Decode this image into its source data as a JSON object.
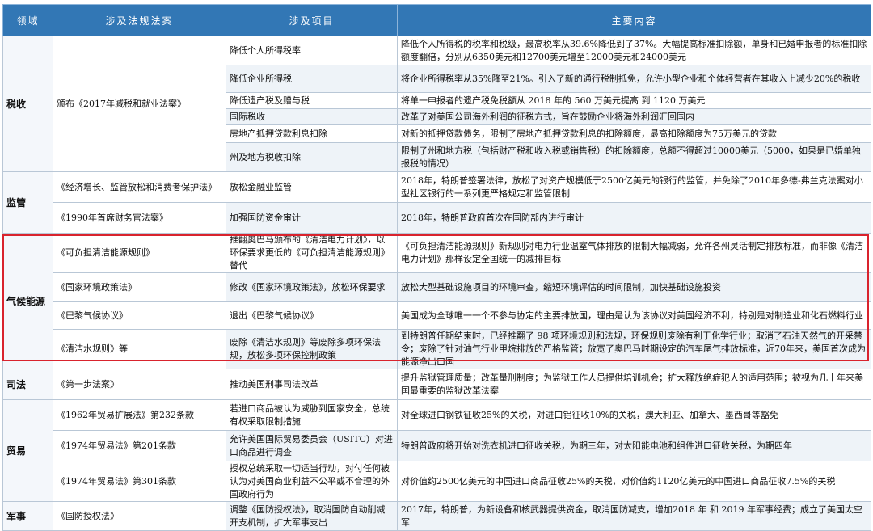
{
  "headers": {
    "domain": "领域",
    "law": "涉及法规法案",
    "item": "涉及项目",
    "content": "主要内容"
  },
  "sections": {
    "tax": {
      "domain": "税收",
      "law": "颁布《2017年减税和就业法案》",
      "rows": [
        {
          "item": "降低个人所得税率",
          "content": "降低个人所得税的税率和税级，最高税率从39.6%降低到了37%。大幅提高标准扣除额，单身和已婚申报者的标准扣除额度翻倍，分别从6350美元和12700美元增至12000美元和24000美元"
        },
        {
          "item": "降低企业所得税",
          "content": "将企业所得税率从35%降至21%。引入了新的通行税制抵免，允许小型企业和个体经营者在其收入上减少20%的税收"
        },
        {
          "item": "降低遗产税及赠与税",
          "content": "将单一申报者的遗产税免税额从 2018 年的 560 万美元提高 到 1120 万美元"
        },
        {
          "item": "国际税收",
          "content": "改革了对美国公司海外利润的征税方式，旨在鼓励企业将海外利润汇回国内"
        },
        {
          "item": "房地产抵押贷款利息扣除",
          "content": "对新的抵押贷款债务，限制了房地产抵押贷款利息的扣除额度，最高扣除额度为75万美元的贷款"
        },
        {
          "item": "州及地方税收扣除",
          "content": "限制了州和地方税（包括财产税和收入税或销售税）的扣除额度，总额不得超过10000美元（5000，如果是已婚单独报税的情况）"
        }
      ]
    },
    "reg": {
      "domain": "监管",
      "rows": [
        {
          "law": "《经济增长、监管放松和消费者保护法》",
          "item": "放松金融业监管",
          "content": "2018年，特朗普签署法律，放松了对资产规模低于2500亿美元的银行的监管，并免除了2010年多德-弗兰克法案对小型社区银行的一系列更严格规定和监管限制"
        },
        {
          "law": "《1990年首席财务官法案》",
          "item": "加强国防资金审计",
          "content": "2018年，特朗普政府首次在国防部内进行审计"
        }
      ]
    },
    "climate": {
      "domain": "气候能源",
      "rows": [
        {
          "law": "《可负担清洁能源规则》",
          "item": "推翻奥巴马颁布的《清洁电力计划》，以环保要求更低的《可负担清洁能源规则》替代",
          "content": "《可负担清洁能源规则》新规则对电力行业温室气体排放的限制大幅减弱，允许各州灵活制定排放标准，而非像《清洁电力计划》那样设定全国统一的减排目标"
        },
        {
          "law": "《国家环境政策法》",
          "item": "修改《国家环境政策法》，放松环保要求",
          "content": "放松大型基础设施项目的环境审查，缩短环境评估的时间限制，加快基础设施投资"
        },
        {
          "law": "《巴黎气候协议》",
          "item": "退出《巴黎气候协议》",
          "content": "美国成为全球唯一一个不参与协定的主要排放国，理由是认为该协议对美国经济不利，特别是对制造业和化石燃料行业"
        },
        {
          "law": "《清洁水规则》等",
          "item": "废除《清洁水规则》等废除多项环保法规，放松多项环保控制政策",
          "content": "到特朗普任期结束时，已经推翻了 98 项环境规则和法规，环保规则废除有利于化学行业；取消了石油天然气的开采禁令；废除了针对油气行业甲烷排放的严格监管；放宽了奥巴马时期设定的汽车尾气排放标准，近70年来，美国首次成为能源净出口国"
        }
      ]
    },
    "justice": {
      "domain": "司法",
      "rows": [
        {
          "law": "《第一步法案》",
          "item": "推动美国刑事司法改革",
          "content": "提升监狱管理质量；改革量刑制度；为监狱工作人员提供培训机会；扩大释放绝症犯人的适用范围；被视为几十年来美国最重要的监狱改革法案"
        }
      ]
    },
    "trade": {
      "domain": "贸易",
      "rows": [
        {
          "law": "《1962年贸易扩展法》第232条款",
          "item": "若进口商品被认为威胁到国家安全，总统有权采取限制措施",
          "content": "对全球进口钢铁征收25%的关税，对进口铝征收10%的关税，澳大利亚、加拿大、墨西哥等豁免"
        },
        {
          "law": "《1974年贸易法》第201条款",
          "item": "允许美国国际贸易委员会（USITC）对进口商品进行调查",
          "content": "特朗普政府将开始对洗衣机进口征收关税，为期三年，对太阳能电池和组件进口征收关税，为期四年"
        },
        {
          "law": "《1974年贸易法》第301条款",
          "item": "授权总统采取一切适当行动，对付任何被认为对美国商业利益不公平或不合理的外国政府行为",
          "content": "对价值约2500亿美元的中国进口商品征收25%的关税，对价值约1120亿美元的中国进口商品征收7.5%的关税"
        }
      ]
    },
    "military": {
      "domain": "军事",
      "rows": [
        {
          "law": "《国防授权法》",
          "item": "调整《国防授权法》，取消国防自动削减开支机制，扩大军事支出",
          "content": "2017年，特朗普，为新设备和核武器提供资金，取消国防减支，增加2018 年 和 2019 年军事经费；成立了美国太空军"
        }
      ]
    }
  }
}
